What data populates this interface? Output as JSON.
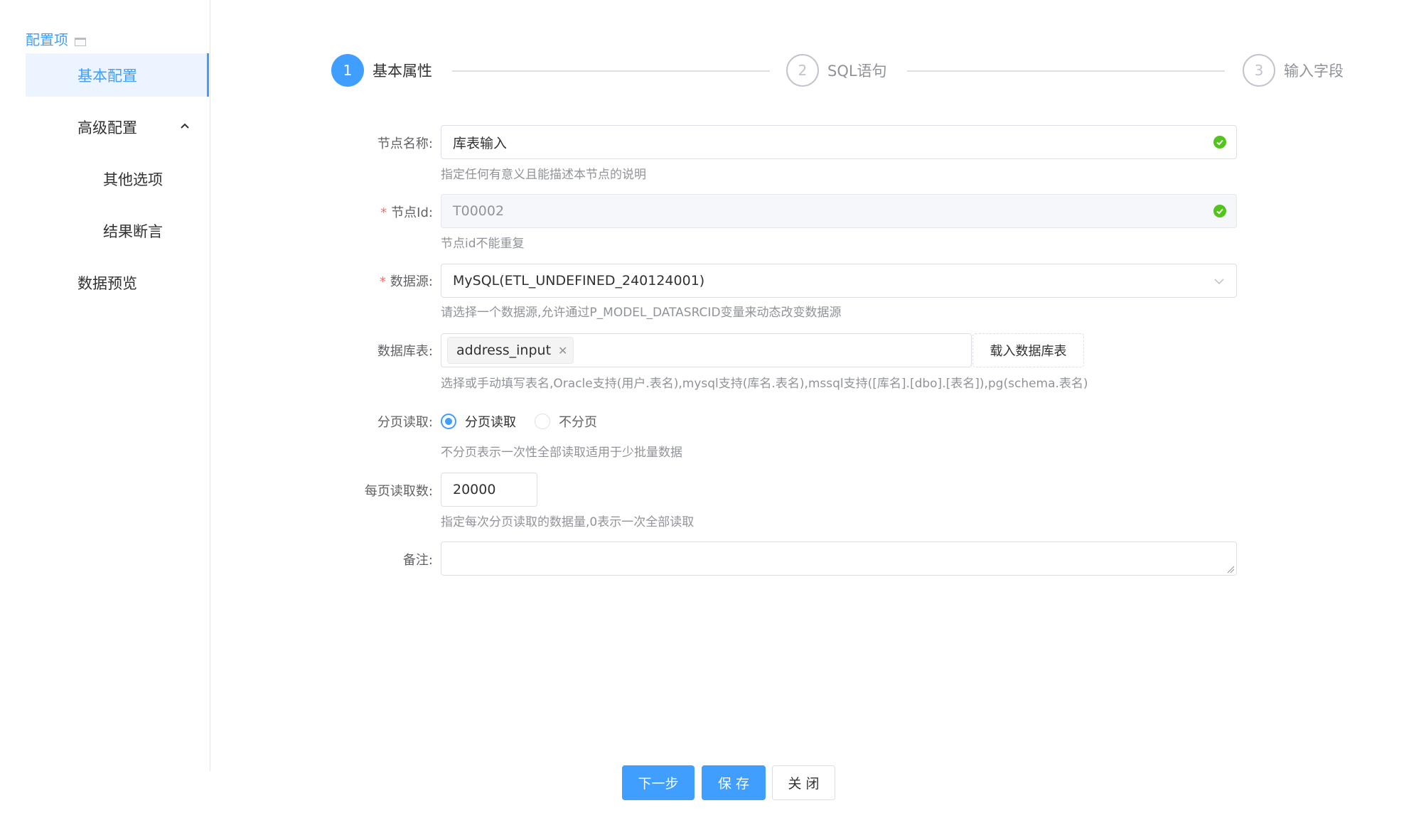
{
  "sidebar": {
    "title": "配置项",
    "items": [
      {
        "label": "基本配置"
      },
      {
        "label": "高级配置"
      },
      {
        "label": "其他选项"
      },
      {
        "label": "结果断言"
      },
      {
        "label": "数据预览"
      }
    ]
  },
  "steps": [
    {
      "num": "1",
      "title": "基本属性",
      "status": "active"
    },
    {
      "num": "2",
      "title": "SQL语句",
      "status": "wait"
    },
    {
      "num": "3",
      "title": "输入字段",
      "status": "wait"
    }
  ],
  "form": {
    "node_name": {
      "label": "节点名称:",
      "value": "库表输入",
      "hint": "指定任何有意义且能描述本节点的说明"
    },
    "node_id": {
      "label": "节点Id:",
      "value": "T00002",
      "hint": "节点id不能重复"
    },
    "datasource": {
      "label": "数据源:",
      "value": "MySQL(ETL_UNDEFINED_240124001)",
      "hint": "请选择一个数据源,允许通过P_MODEL_DATASRCID变量来动态改变数据源"
    },
    "db_table": {
      "label": "数据库表:",
      "tag": "address_input",
      "load_button": "载入数据库表",
      "hint": "选择或手动填写表名,Oracle支持(用户.表名),mysql支持(库名.表名),mssql支持([库名].[dbo].[表名]),pg(schema.表名)"
    },
    "paging": {
      "label": "分页读取:",
      "options": [
        "分页读取",
        "不分页"
      ],
      "selected": "分页读取",
      "hint": "不分页表示一次性全部读取适用于少批量数据"
    },
    "page_size": {
      "label": "每页读取数:",
      "value": "20000",
      "hint": "指定每次分页读取的数据量,0表示一次全部读取"
    },
    "remark": {
      "label": "备注:",
      "value": ""
    }
  },
  "required_mark": "*",
  "buttons": {
    "next": "下一步",
    "save": "保 存",
    "close": "关 闭"
  },
  "colors": {
    "primary": "#409eff",
    "success": "#52c41a",
    "required": "#f56c6c"
  }
}
